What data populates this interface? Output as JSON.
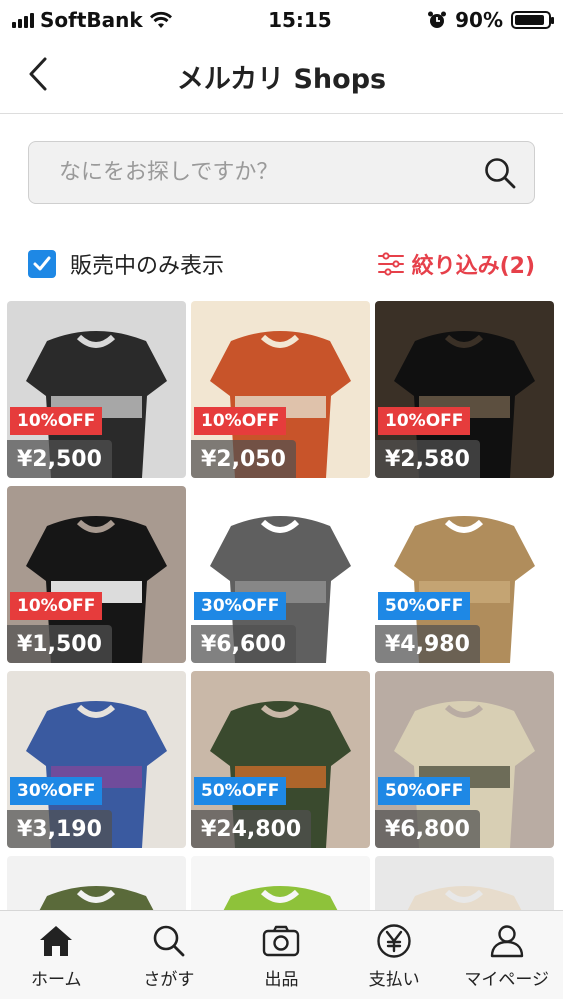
{
  "status_bar": {
    "carrier": "SoftBank",
    "time": "15:15",
    "battery": "90%",
    "battery_level": 0.9
  },
  "nav": {
    "title": "メルカリ Shops"
  },
  "search": {
    "placeholder": "なにをお探しですか？"
  },
  "filters": {
    "on_sale_only_label": "販売中のみ表示",
    "on_sale_only_checked": true,
    "refine_label": "絞り込み(2)"
  },
  "products": [
    {
      "discount": "10%OFF",
      "price": "¥2,500",
      "badge_color": "#e63c3c",
      "tone": [
        "#d8d8d8",
        "#2a2a2a",
        "#bdbdbd"
      ]
    },
    {
      "discount": "10%OFF",
      "price": "¥2,050",
      "badge_color": "#e63c3c",
      "tone": [
        "#f2e6d2",
        "#c8542a",
        "#e3d6c2"
      ]
    },
    {
      "discount": "10%OFF",
      "price": "¥2,580",
      "badge_color": "#e63c3c",
      "tone": [
        "#3a3026",
        "#101010",
        "#6a5a48"
      ]
    },
    {
      "discount": "10%OFF",
      "price": "¥1,500",
      "badge_color": "#e63c3c",
      "tone": [
        "#a89a90",
        "#161616",
        "#ffffff"
      ]
    },
    {
      "discount": "30%OFF",
      "price": "¥6,600",
      "badge_color": "#1e88e5",
      "tone": [
        "#ffffff",
        "#5f5f5f",
        "#8e8e8e"
      ]
    },
    {
      "discount": "50%OFF",
      "price": "¥4,980",
      "badge_color": "#1e88e5",
      "tone": [
        "#ffffff",
        "#b08d5c",
        "#c8a877"
      ]
    },
    {
      "discount": "30%OFF",
      "price": "¥3,190",
      "badge_color": "#1e88e5",
      "tone": [
        "#e6e2dc",
        "#3a5aa0",
        "#7a4a9a"
      ]
    },
    {
      "discount": "50%OFF",
      "price": "¥24,800",
      "badge_color": "#1e88e5",
      "tone": [
        "#c9b8a8",
        "#3a4a2e",
        "#c26a2a"
      ]
    },
    {
      "discount": "50%OFF",
      "price": "¥6,800",
      "badge_color": "#1e88e5",
      "tone": [
        "#b9aca3",
        "#d8cfb4",
        "#5a5a48"
      ]
    },
    {
      "discount": "",
      "price": "",
      "badge_color": "",
      "tone": [
        "#f2f2f2",
        "#5a6a3a",
        "#6e7e4a"
      ]
    },
    {
      "discount": "",
      "price": "",
      "badge_color": "",
      "tone": [
        "#f6f6f6",
        "#8ec23a",
        "#a6d24a"
      ]
    },
    {
      "discount": "",
      "price": "",
      "badge_color": "",
      "tone": [
        "#e8e8e8",
        "#e7dccc",
        "#d8ccb8"
      ]
    }
  ],
  "tabs": [
    {
      "label": "ホーム",
      "icon": "home-icon"
    },
    {
      "label": "さがす",
      "icon": "search-icon"
    },
    {
      "label": "出品",
      "icon": "camera-icon"
    },
    {
      "label": "支払い",
      "icon": "yen-icon"
    },
    {
      "label": "マイページ",
      "icon": "person-icon"
    }
  ]
}
